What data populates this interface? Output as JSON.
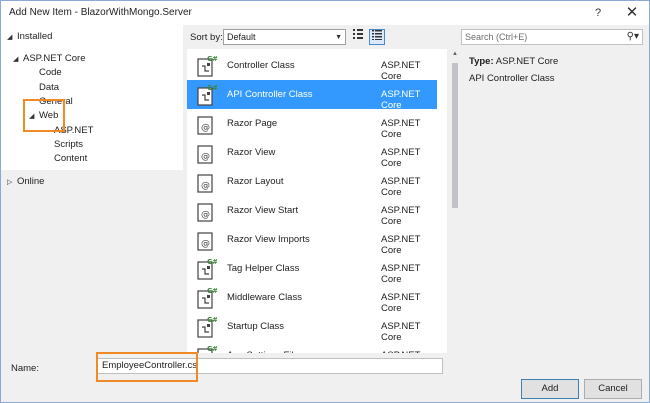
{
  "window": {
    "title": "Add New Item - BlazorWithMongo.Server",
    "help_glyph": "?",
    "close_glyph": "✕"
  },
  "tree": {
    "installed": "Installed",
    "aspnet_core": "ASP.NET Core",
    "code": "Code",
    "data": "Data",
    "general": "General",
    "web": "Web",
    "web_aspnet": "ASP.NET",
    "scripts": "Scripts",
    "content": "Content",
    "online": "Online"
  },
  "toolbar": {
    "sort_label": "Sort by:",
    "sort_value": "Default",
    "search_placeholder": "Search (Ctrl+E)"
  },
  "items": [
    {
      "name": "Controller Class",
      "category": "ASP.NET Core",
      "icon": "csharp-class-icon"
    },
    {
      "name": "API Controller Class",
      "category": "ASP.NET Core",
      "icon": "csharp-class-icon",
      "selected": true
    },
    {
      "name": "Razor Page",
      "category": "ASP.NET Core",
      "icon": "razor-icon"
    },
    {
      "name": "Razor View",
      "category": "ASP.NET Core",
      "icon": "razor-icon"
    },
    {
      "name": "Razor Layout",
      "category": "ASP.NET Core",
      "icon": "razor-icon"
    },
    {
      "name": "Razor View Start",
      "category": "ASP.NET Core",
      "icon": "razor-icon"
    },
    {
      "name": "Razor View Imports",
      "category": "ASP.NET Core",
      "icon": "razor-icon"
    },
    {
      "name": "Tag Helper Class",
      "category": "ASP.NET Core",
      "icon": "csharp-class-icon"
    },
    {
      "name": "Middleware Class",
      "category": "ASP.NET Core",
      "icon": "csharp-class-icon"
    },
    {
      "name": "Startup Class",
      "category": "ASP.NET Core",
      "icon": "csharp-class-icon"
    },
    {
      "name": "App Settings File",
      "category": "ASP.NET Core",
      "icon": "csharp-class-icon"
    }
  ],
  "details": {
    "type_label": "Type:",
    "type_value": "ASP.NET Core",
    "description": "API Controller Class"
  },
  "footer": {
    "name_label": "Name:",
    "name_value": "EmployeeController.cs",
    "add_label": "Add",
    "cancel_label": "Cancel"
  }
}
